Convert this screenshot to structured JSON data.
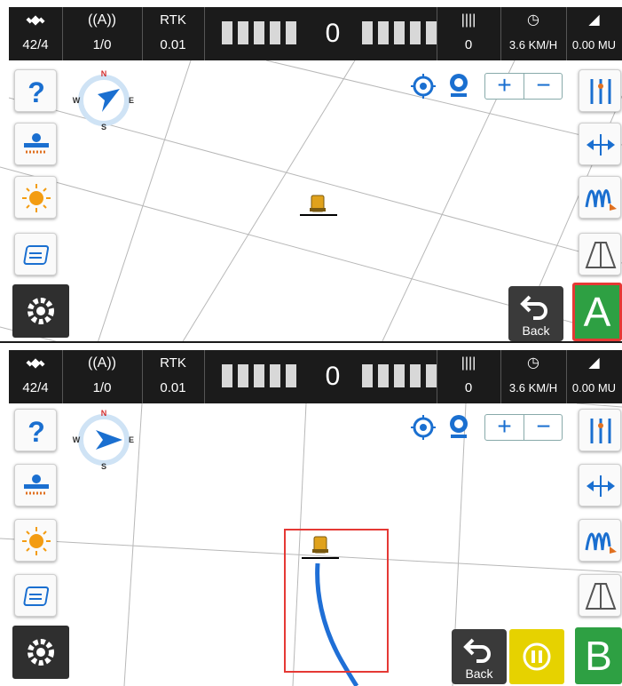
{
  "panels": [
    {
      "status": {
        "satellites": "42/4",
        "signal": "1/0",
        "rtk_label": "RTK",
        "rtk_value": "0.01",
        "steering_value": "0",
        "lines_value": "0",
        "speed": "3.6 KM/H",
        "area": "0.00 MU"
      },
      "compass": {
        "n": "N",
        "s": "S",
        "e": "E",
        "w": "W"
      },
      "back_label": "Back",
      "ab_label": "A"
    },
    {
      "status": {
        "satellites": "42/4",
        "signal": "1/0",
        "rtk_label": "RTK",
        "rtk_value": "0.01",
        "steering_value": "0",
        "lines_value": "0",
        "speed": "3.6 KM/H",
        "area": "0.00 MU"
      },
      "compass": {
        "n": "N",
        "s": "S",
        "e": "E",
        "w": "W"
      },
      "back_label": "Back",
      "ab_label": "B"
    }
  ],
  "colors": {
    "accent_blue": "#1a6fd0",
    "a_button": "#2ea043",
    "a_button_border": "#e53935",
    "pause_yellow": "#e6d200",
    "highlight_box": "#e53935",
    "track_line": "#1f6fd6"
  },
  "icons": {
    "satellite": "satellite-icon",
    "antenna": "antenna-icon",
    "rows": "rows-icon",
    "speedometer": "speedometer-icon",
    "area": "area-icon"
  }
}
